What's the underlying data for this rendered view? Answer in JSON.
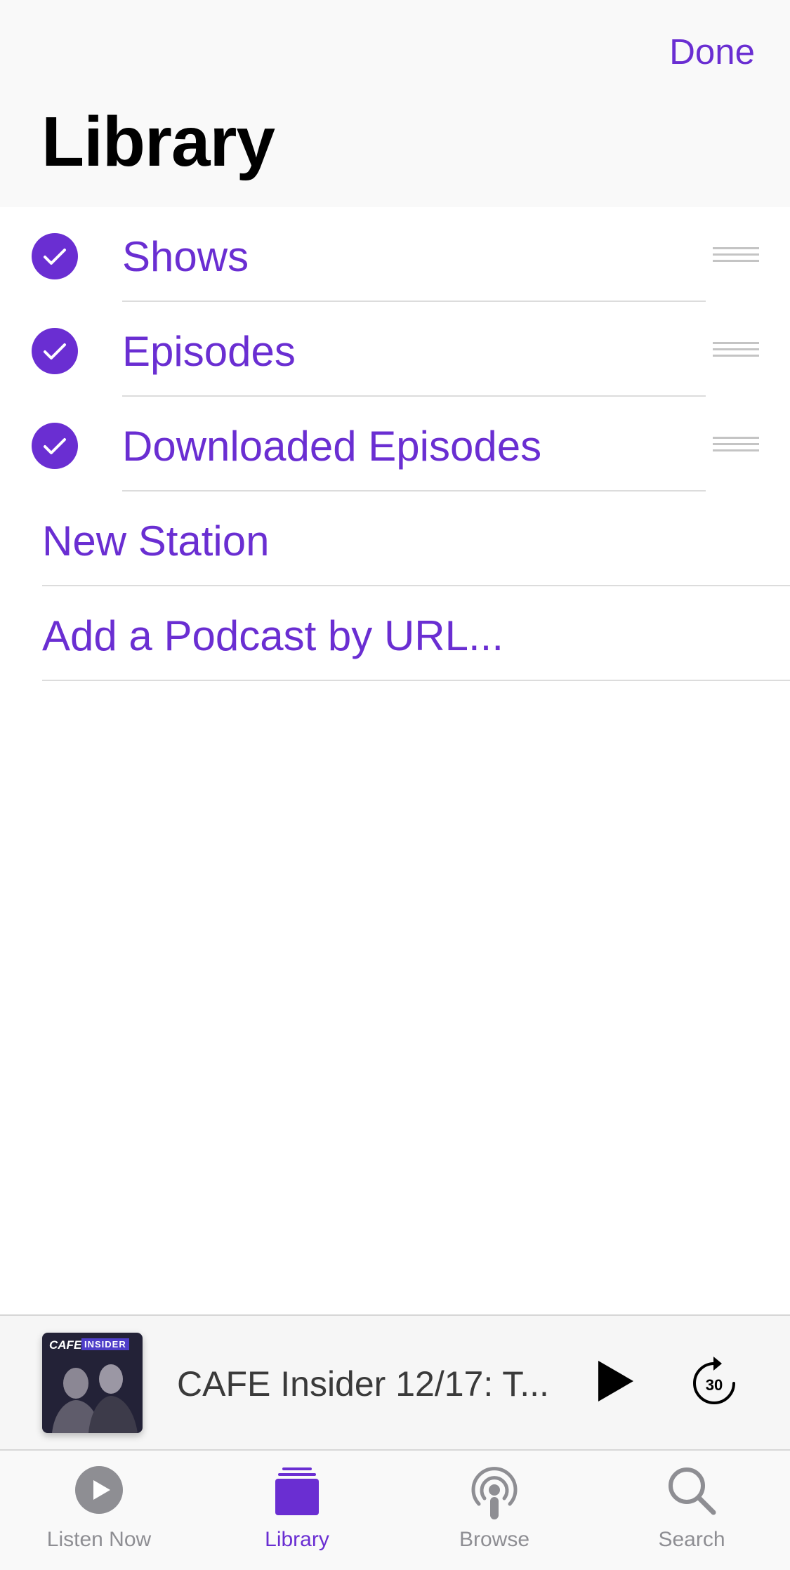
{
  "header": {
    "done_label": "Done",
    "title": "Library"
  },
  "sections": [
    {
      "label": "Shows",
      "checked": true
    },
    {
      "label": "Episodes",
      "checked": true
    },
    {
      "label": "Downloaded Episodes",
      "checked": true
    }
  ],
  "actions": [
    {
      "label": "New Station"
    },
    {
      "label": "Add a Podcast by URL..."
    }
  ],
  "now_playing": {
    "title": "CAFE Insider 12/17: T...",
    "artwork_logo": "CAFE",
    "artwork_badge": "INSIDER",
    "skip_seconds": "30"
  },
  "tabs": [
    {
      "label": "Listen Now",
      "icon": "play-circle-icon",
      "active": false
    },
    {
      "label": "Library",
      "icon": "library-stack-icon",
      "active": true
    },
    {
      "label": "Browse",
      "icon": "podcast-broadcast-icon",
      "active": false
    },
    {
      "label": "Search",
      "icon": "magnifier-icon",
      "active": false
    }
  ],
  "colors": {
    "accent": "#6a2ed2",
    "inactive": "#8e8e93"
  }
}
